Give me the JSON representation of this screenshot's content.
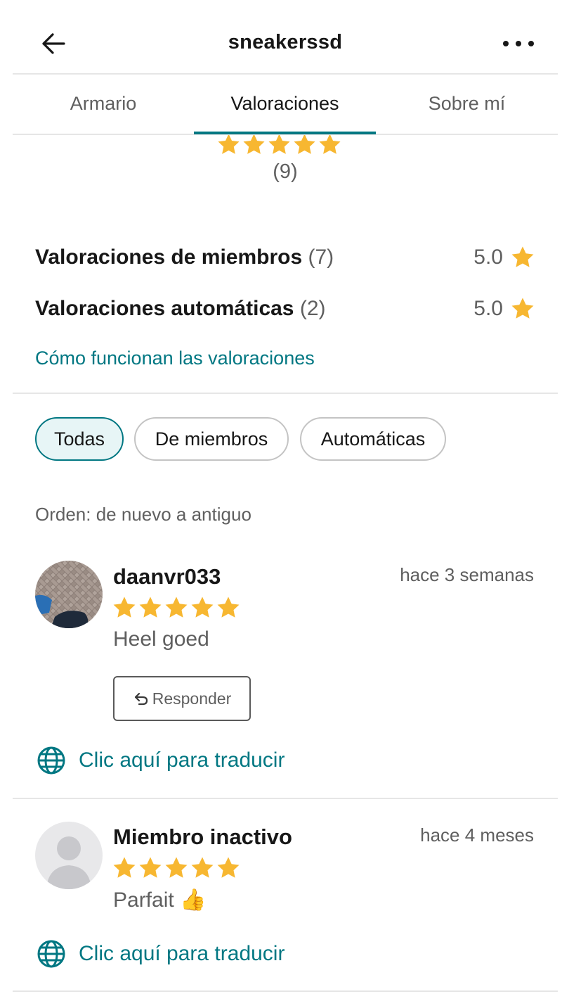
{
  "header": {
    "title": "sneakerssd",
    "back_icon": "arrow-left-icon",
    "more_icon": "more-horizontal-icon"
  },
  "tabs": [
    {
      "label": "Armario",
      "active": false
    },
    {
      "label": "Valoraciones",
      "active": true
    },
    {
      "label": "Sobre mí",
      "active": false
    }
  ],
  "summary": {
    "rating_stars": 5,
    "total_count": "(9)",
    "rows": [
      {
        "label": "Valoraciones de miembros",
        "count": "(7)",
        "value": "5.0"
      },
      {
        "label": "Valoraciones automáticas",
        "count": "(2)",
        "value": "5.0"
      }
    ],
    "how_link": "Cómo funcionan las valoraciones"
  },
  "filters": [
    {
      "label": "Todas",
      "active": true
    },
    {
      "label": "De miembros",
      "active": false
    },
    {
      "label": "Automáticas",
      "active": false
    }
  ],
  "sort_label": "Orden: de nuevo a antiguo",
  "reviews": [
    {
      "user": "daanvr033",
      "time": "hace 3 semanas",
      "stars": 5,
      "text": "Heel goed",
      "reply_label": "Responder",
      "translate_label": "Clic aquí para traducir"
    },
    {
      "user": "Miembro inactivo",
      "time": "hace 4 meses",
      "stars": 5,
      "text": "Parfait 👍",
      "translate_label": "Clic aquí para traducir"
    }
  ],
  "colors": {
    "accent": "#007782",
    "star": "#f7b731",
    "muted_text": "#5f5f5f",
    "divider": "#e6e6e6"
  }
}
